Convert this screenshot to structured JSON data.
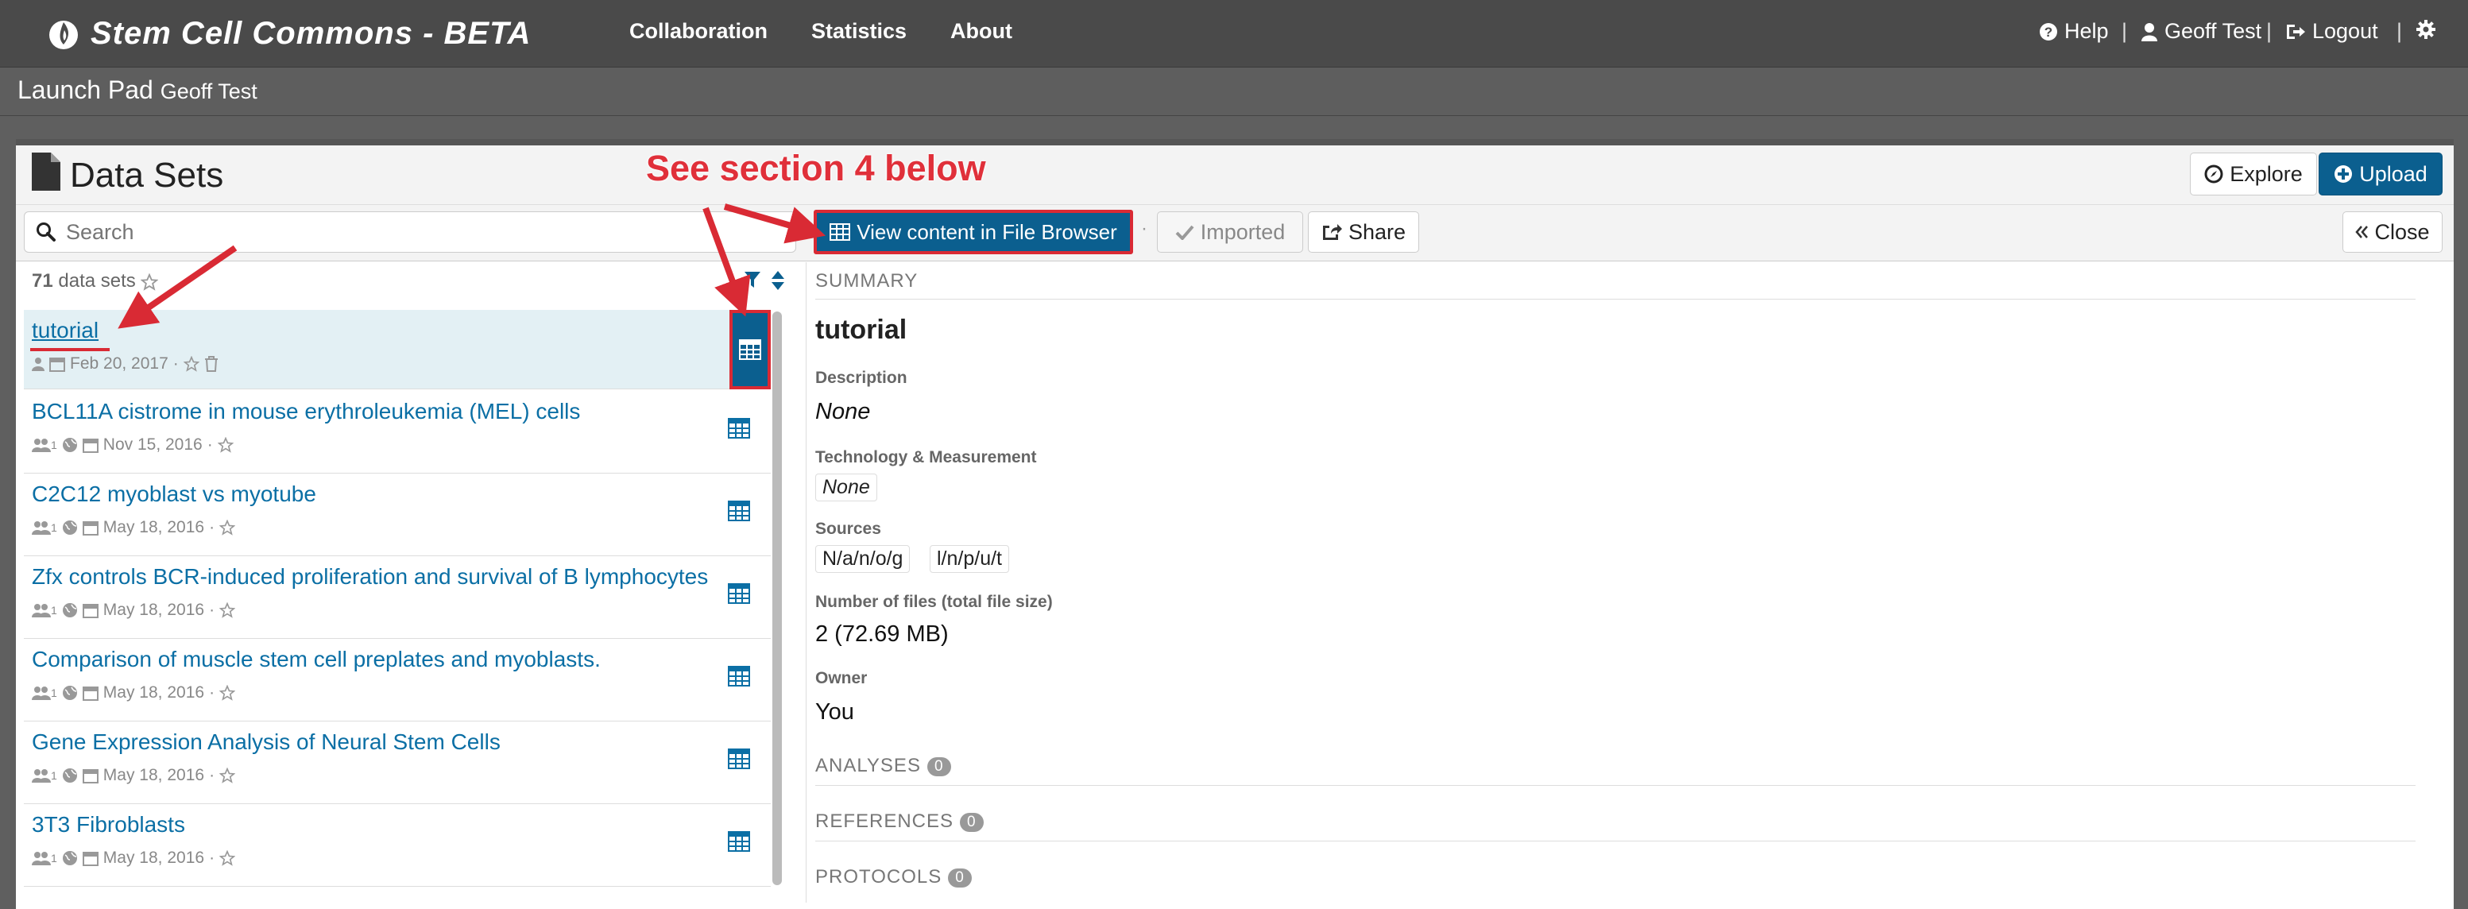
{
  "nav": {
    "brand": "Stem Cell Commons - BETA",
    "links": [
      "Collaboration",
      "Statistics",
      "About"
    ],
    "help": "Help",
    "user": "Geoff Test",
    "logout": "Logout",
    "sep": "|"
  },
  "launchpad": {
    "title": "Launch Pad",
    "user": "Geoff Test"
  },
  "panel": {
    "title": "Data Sets",
    "explore": "Explore",
    "upload": "Upload",
    "search_placeholder": "Search",
    "view_in_browser": "View content in File Browser",
    "dot": "·",
    "imported": "Imported",
    "share": "Share",
    "close": "Close",
    "count_num": "71",
    "count_label": "data sets"
  },
  "datasets": [
    {
      "title": "tutorial",
      "date": "Feb 20, 2017",
      "selected": true,
      "group_count": ""
    },
    {
      "title": "BCL11A cistrome in mouse erythroleukemia (MEL) cells",
      "date": "Nov 15, 2016",
      "group_count": "1"
    },
    {
      "title": "C2C12 myoblast vs myotube",
      "date": "May 18, 2016",
      "group_count": "1"
    },
    {
      "title": "Zfx controls BCR-induced proliferation and survival of B lymphocytes",
      "date": "May 18, 2016",
      "group_count": "1"
    },
    {
      "title": "Comparison of muscle stem cell preplates and myoblasts.",
      "date": "May 18, 2016",
      "group_count": "1"
    },
    {
      "title": "Gene Expression Analysis of Neural Stem Cells",
      "date": "May 18, 2016",
      "group_count": "1"
    },
    {
      "title": "3T3 Fibroblasts",
      "date": "May 18, 2016",
      "group_count": "1"
    }
  ],
  "summary": {
    "heading": "SUMMARY",
    "title": "tutorial",
    "description_label": "Description",
    "description": "None",
    "tech_label": "Technology & Measurement",
    "tech": "None",
    "sources_label": "Sources",
    "sources": [
      "N/a/n/o/g",
      "l/n/p/u/t"
    ],
    "files_label": "Number of files (total file size)",
    "files": "2 (72.69 MB)",
    "owner_label": "Owner",
    "owner": "You",
    "analyses": "ANALYSES",
    "analyses_count": "0",
    "references": "REFERENCES",
    "references_count": "0",
    "protocols": "PROTOCOLS",
    "protocols_count": "0"
  },
  "annotation": {
    "text": "See section 4 below"
  },
  "colors": {
    "accent": "#0b5f8f",
    "link": "#0b6fa5",
    "annotation": "#e0303a",
    "navbar": "#4a4a4a"
  }
}
